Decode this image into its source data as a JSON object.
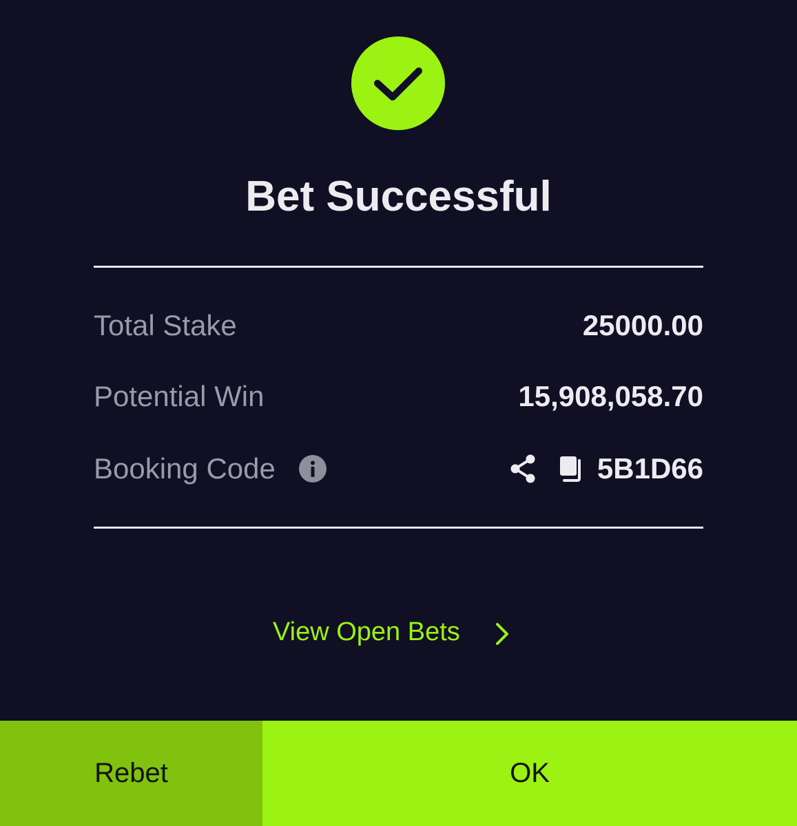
{
  "dialog": {
    "title": "Bet Successful",
    "colors": {
      "background": "#100f24",
      "accent": "#9bf213",
      "accent_dark": "#80c20d",
      "label": "#9b9aa8",
      "value": "#ececf0"
    },
    "icons": {
      "status": "check-circle-icon",
      "info": "info-icon",
      "share": "share-icon",
      "copy": "copy-icon",
      "chevron": "chevron-right-icon"
    }
  },
  "summary": {
    "total_stake_label": "Total Stake",
    "total_stake_value": "25000.00",
    "potential_win_label": "Potential Win",
    "potential_win_value": "15,908,058.70",
    "booking_code_label": "Booking Code",
    "booking_code_value": "5B1D66"
  },
  "links": {
    "view_open_bets": "View Open Bets"
  },
  "actions": {
    "rebet_label": "Rebet",
    "ok_label": "OK"
  }
}
